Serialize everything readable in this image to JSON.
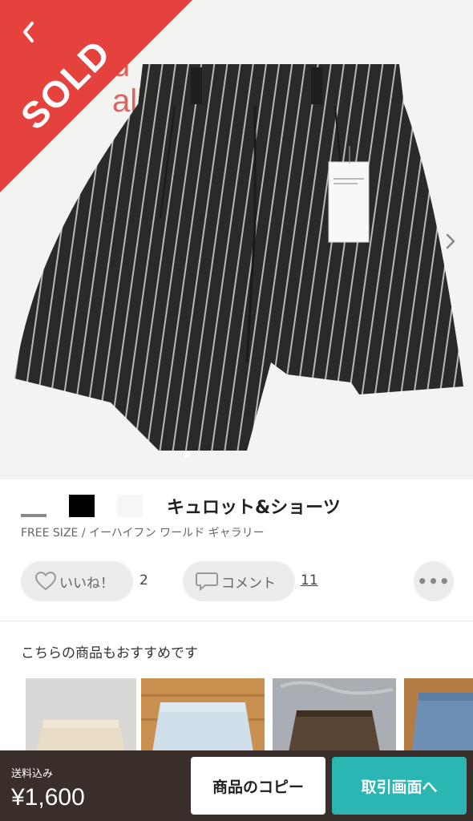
{
  "hero": {
    "sold_label": "SOLD",
    "wall_text": [
      "",
      "d",
      "allery"
    ],
    "back_icon": "chevron-left-icon",
    "next_icon": "chevron-right-icon"
  },
  "product": {
    "title": "キュロット&ショーツ",
    "subtitle": "FREE SIZE / イーハイフン ワールド ギャラリー",
    "swatch_colors": [
      "#888888",
      "#000000",
      "#f6f6f6"
    ]
  },
  "actions": {
    "like_label": "いいね！",
    "like_count": "2",
    "comment_label": "コメント",
    "comment_count": "11",
    "more_icon": "more-horizontal-icon",
    "more_glyph": "•••"
  },
  "recommendations": {
    "heading": "こちらの商品もおすすめです"
  },
  "bottom_bar": {
    "shipping_label": "送料込み",
    "price": "¥1,600",
    "copy_button": "商品のコピー",
    "trade_button": "取引画面へ"
  },
  "colors": {
    "sold_red": "#e5423e",
    "bar_brown": "#3a2e2a",
    "accent_teal": "#2bb6b3"
  }
}
